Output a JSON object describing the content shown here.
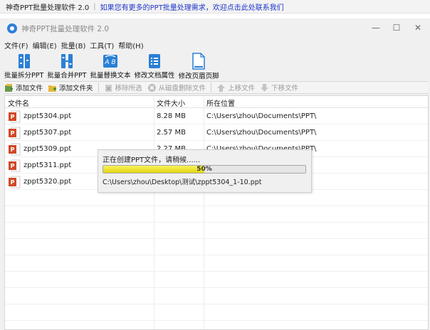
{
  "banner": {
    "app_title": "神奇PPT批量处理软件 2.0",
    "promo": "如果您有更多的PPT批量处理需求，欢迎点击此处联系我们"
  },
  "window": {
    "title": "神奇PPT批量处理软件 2.0",
    "controls": {
      "minimize": "—",
      "maximize": "☐",
      "close": "✕"
    }
  },
  "menu": [
    {
      "label": "文件(F)"
    },
    {
      "label": "编辑(E)"
    },
    {
      "label": "批量(B)"
    },
    {
      "label": "工具(T)"
    },
    {
      "label": "帮助(H)"
    }
  ],
  "toolbar": [
    {
      "label": "批量拆分PPT",
      "icon": "split-icon"
    },
    {
      "label": "批量合并PPT",
      "icon": "merge-icon"
    },
    {
      "label": "批量替换文本",
      "icon": "replace-text-icon"
    },
    {
      "label": "修改文档属性",
      "icon": "properties-icon"
    },
    {
      "label": "修改页眉页脚",
      "icon": "header-footer-icon"
    }
  ],
  "actions": [
    {
      "label": "添加文件",
      "enabled": true
    },
    {
      "label": "添加文件夹",
      "enabled": true
    },
    {
      "label": "移除所选",
      "enabled": false
    },
    {
      "label": "从磁盘删除文件",
      "enabled": false
    },
    {
      "label": "上移文件",
      "enabled": false
    },
    {
      "label": "下移文件",
      "enabled": false
    }
  ],
  "table": {
    "columns": [
      "文件名",
      "文件大小",
      "所在位置"
    ],
    "rows": [
      {
        "name": "zppt5304.ppt",
        "size": "8.28 MB",
        "location": "C:\\Users\\zhou\\Documents\\PPT\\"
      },
      {
        "name": "zppt5307.ppt",
        "size": "2.57 MB",
        "location": "C:\\Users\\zhou\\Documents\\PPT\\"
      },
      {
        "name": "zppt5309.ppt",
        "size": "2.27 MB",
        "location": "C:\\Users\\zhou\\Documents\\PPT\\"
      },
      {
        "name": "zppt5311.ppt",
        "size": "",
        "location": ""
      },
      {
        "name": "zppt5320.ppt",
        "size": "",
        "location": ""
      }
    ]
  },
  "progress_dialog": {
    "message": "正在创建PPT文件，请稍候......",
    "percent_label": "50%",
    "progress": 0.5,
    "current_file": "C:\\Users\\zhou\\Desktop\\测试\\zppt5304_1-10.ppt"
  },
  "colors": {
    "promo_link": "#1d35c8",
    "progress_fill": "#efe23a",
    "toolbar_icon": "#2a7fd6",
    "ppt_icon": "#d24726"
  }
}
